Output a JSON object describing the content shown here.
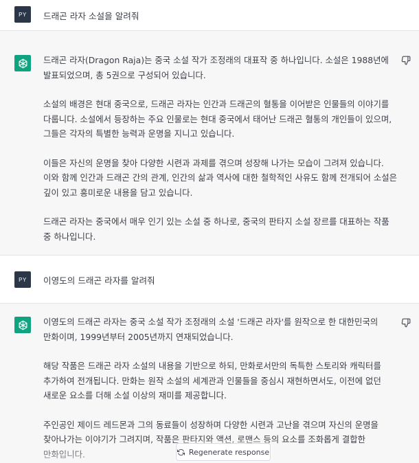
{
  "user_avatar": "PY",
  "bot_avatar_icon": "openai-logo-icon",
  "colors": {
    "user_avatar_bg": "#2b3648",
    "bot_avatar_bg": "#10a37f",
    "assistant_bg": "#f7f7f8"
  },
  "messages": [
    {
      "role": "user",
      "text": "드래곤 라자 소설을 알려줘"
    },
    {
      "role": "assistant",
      "paragraphs": [
        "드래곤 라자(Dragon Raja)는 중국 소설 작가 조정래의 대표작 중 하나입니다. 소설은 1988년에 발표되었으며, 총 5권으로 구성되어 있습니다.",
        "소설의 배경은 현대 중국으로, 드래곤 라자는 인간과 드래곤의 혈통을 이어받은 인물들의 이야기를 다룹니다. 소설에서 등장하는 주요 인물로는 현대 중국에서 태어난 드래곤 혈통의 개인들이 있으며, 그들은 각자의 특별한 능력과 운명을 지니고 있습니다.",
        "이들은 자신의 운명을 찾아 다양한 시련과 과제를 겪으며 성장해 나가는 모습이 그려져 있습니다. 이와 함께 인간과 드래곤 간의 관계, 인간의 삶과 역사에 대한 철학적인 사유도 함께 전개되어 소설은 깊이 있고 흥미로운 내용을 담고 있습니다.",
        "드래곤 라자는 중국에서 매우 인기 있는 소설 중 하나로, 중국의 판타지 소설 장르를 대표하는 작품 중 하나입니다."
      ]
    },
    {
      "role": "user",
      "text": "이영도의 드래곤 라자를 알려줘"
    },
    {
      "role": "assistant",
      "paragraphs": [
        "이영도의 드래곤 라자는 중국 소설 작가 조정래의 소설 '드래곤 라자'를 원작으로 한 대한민국의 만화이며, 1999년부터 2005년까지 연재되었습니다.",
        "해당 작품은 드래곤 라자 소설의 내용을 기반으로 하되, 만화로서만의 독특한 스토리와 캐릭터를 추가하여 전개됩니다. 만화는 원작 소설의 세계관과 인물들을 중심시 재현하면서도, 이전에 없던 새로운 요소를 더해 소설 이상의 재미를 제공합니다.",
        "주인공인 제이드 레드몬과 그의 동료들이 성장하며 다양한 시련과 고난을 겪으며 자신의 운명을 찾아나가는 이야기가 그려지며, 작품은 판타지와 액션, 로맨스 등의 요소를 조화롭게 결합한 만화입니다."
      ]
    }
  ],
  "regenerate_label": "Regenerate response"
}
